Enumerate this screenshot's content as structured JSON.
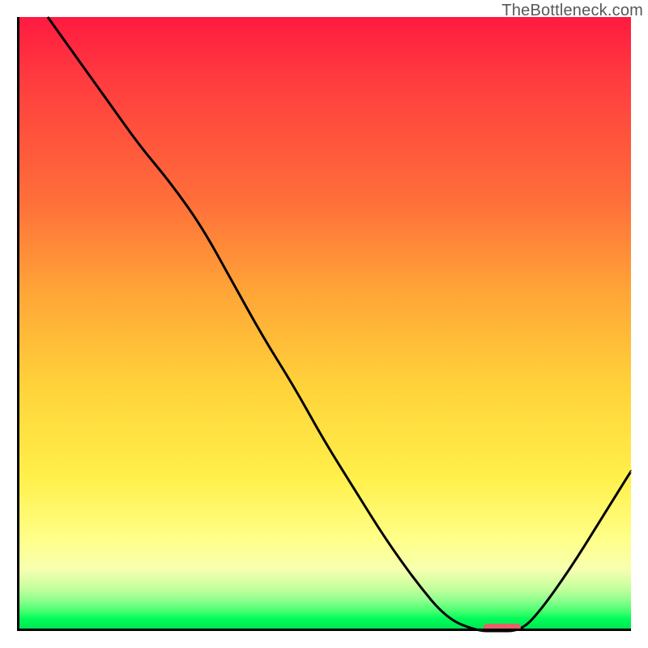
{
  "watermark": "TheBottleneck.com",
  "colors": {
    "curve_stroke": "#000000",
    "dash_color": "#e95f68",
    "axis_color": "#000000"
  },
  "chart_data": {
    "type": "line",
    "title": "",
    "xlabel": "",
    "ylabel": "",
    "xlim": [
      0,
      100
    ],
    "ylim": [
      0,
      100
    ],
    "grid": false,
    "legend": false,
    "note": "Bottleneck percentage curve; background gradient encodes severity (red=high, green=low). Values estimated from pixel positions; no tick labels present.",
    "series": [
      {
        "name": "curve",
        "x": [
          5,
          10,
          15,
          20,
          25,
          30,
          35,
          40,
          45,
          50,
          55,
          60,
          65,
          70,
          75,
          78,
          82,
          85,
          90,
          95,
          100
        ],
        "y": [
          100,
          93,
          86,
          79,
          73,
          66,
          57,
          48,
          40,
          31,
          23,
          15,
          8,
          2,
          0,
          0,
          0,
          3,
          10,
          18,
          26
        ]
      }
    ],
    "marker": {
      "name": "optimal-range",
      "x_start": 76,
      "x_end": 82,
      "y": 0.6
    }
  },
  "plot_geometry": {
    "inner_left": 21,
    "inner_top": 21,
    "inner_width": 758,
    "inner_height": 758
  }
}
